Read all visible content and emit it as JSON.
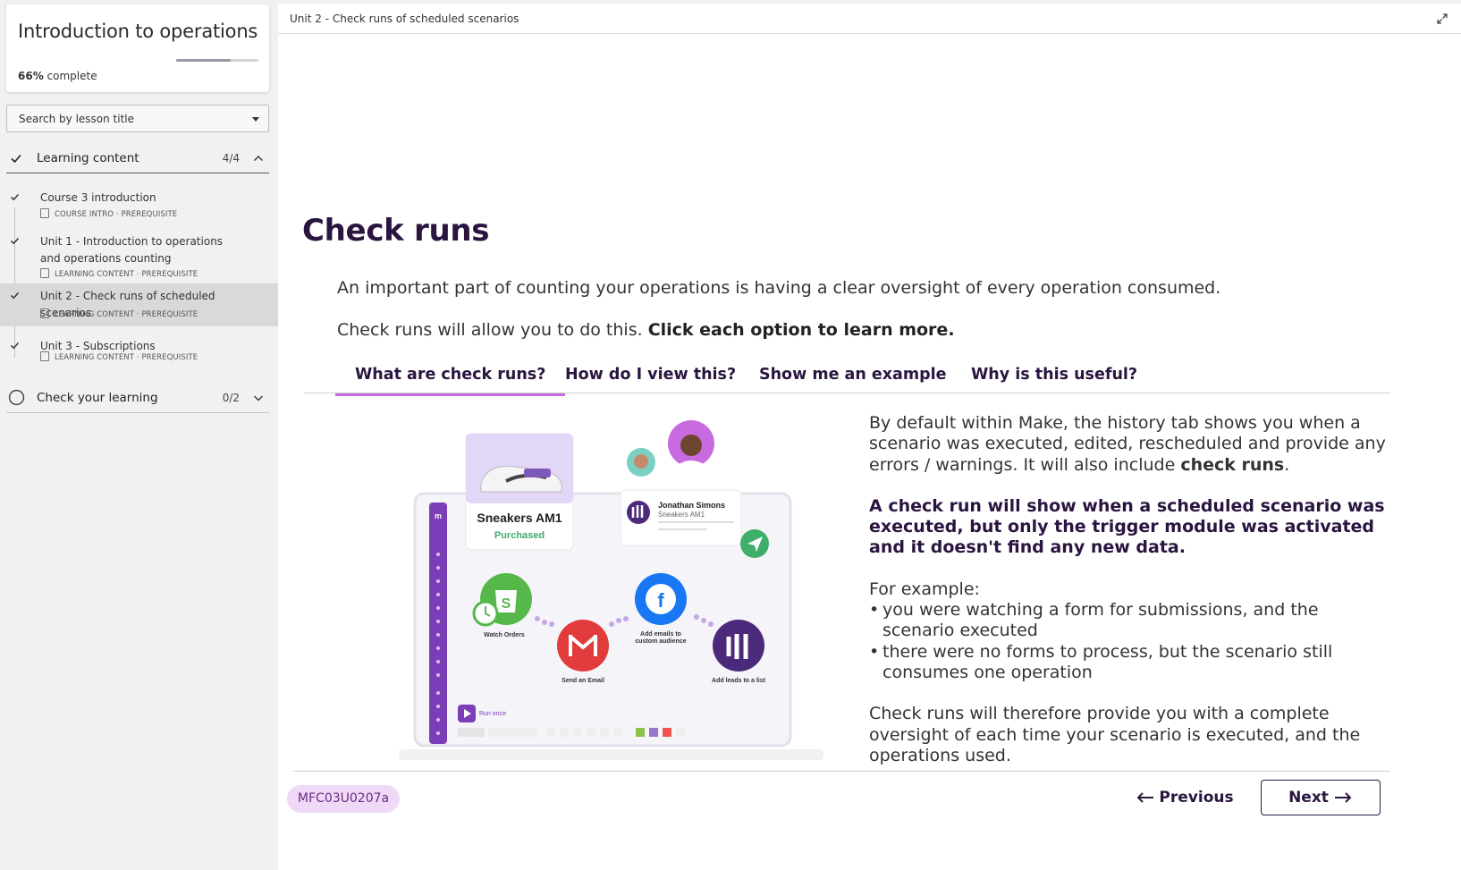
{
  "sidebar": {
    "course_title": "Introduction to operations",
    "progress_percent": 66,
    "progress_value": "66%",
    "progress_suffix": " complete",
    "search_placeholder": "Search by lesson title",
    "sections": [
      {
        "label": "Learning content",
        "count": "4/4",
        "expanded": true,
        "completed": true
      },
      {
        "label": "Check your learning",
        "count": "0/2",
        "expanded": false,
        "completed": false
      }
    ],
    "lessons": [
      {
        "title": "Course 3 introduction",
        "meta": "COURSE INTRO · PREREQUISITE"
      },
      {
        "title": "Unit 1 - Introduction to operations and operations counting",
        "meta": "LEARNING CONTENT · PREREQUISITE"
      },
      {
        "title": "Unit 2 - Check runs of scheduled scenarios",
        "meta": "LEARNING CONTENT · PREREQUISITE",
        "active": true
      },
      {
        "title": "Unit 3 - Subscriptions",
        "meta": "LEARNING CONTENT · PREREQUISITE"
      }
    ]
  },
  "header": {
    "breadcrumb": "Unit 2 - Check runs of scheduled scenarios"
  },
  "content": {
    "heading": "Check runs",
    "intro1": "An important part of counting your operations is having a clear oversight of every operation consumed.",
    "intro2_plain": "Check runs will allow you to do this. ",
    "intro2_bold": "Click each option to learn more.",
    "tabs": [
      "What are check runs?",
      "How do I view this?",
      "Show me an example",
      "Why is this useful?"
    ],
    "active_tab": 0,
    "illustration": {
      "product_name": "Sneakers AM1",
      "product_status": "Purchased",
      "contact_name": "Jonathan Simons",
      "contact_sub": "Sneakers AM1",
      "module_watch": "Watch Orders",
      "module_email": "Send an Email",
      "module_fb_line1": "Add emails to",
      "module_fb_line2": "custom audience",
      "module_list": "Add leads to a list",
      "run_once": "Run once"
    },
    "desc_p1_plain": "By default within Make, the history tab shows you when a scenario was executed, edited, rescheduled and provide any errors / warnings. It will also include ",
    "desc_p1_bold": "check runs",
    "desc_p1_end": ".",
    "desc_p2": "A check run will show when a scheduled scenario was executed, but only the trigger module was activated and it doesn't find any new data.",
    "desc_p3_intro": "For example:",
    "desc_bullets": [
      "you were watching a form for submissions, and the scenario executed",
      "there were no forms to process, but the scenario still consumes one operation"
    ],
    "desc_p4": "Check runs will therefore provide you with a complete oversight of each time your scenario is executed, and the operations used."
  },
  "footer": {
    "code": "MFC03U0207a",
    "previous_label": "Previous",
    "next_label": "Next"
  },
  "colors": {
    "accent_purple": "#2a1540",
    "tab_underline": "#c86be0",
    "pill_bg": "#efd9f6"
  }
}
